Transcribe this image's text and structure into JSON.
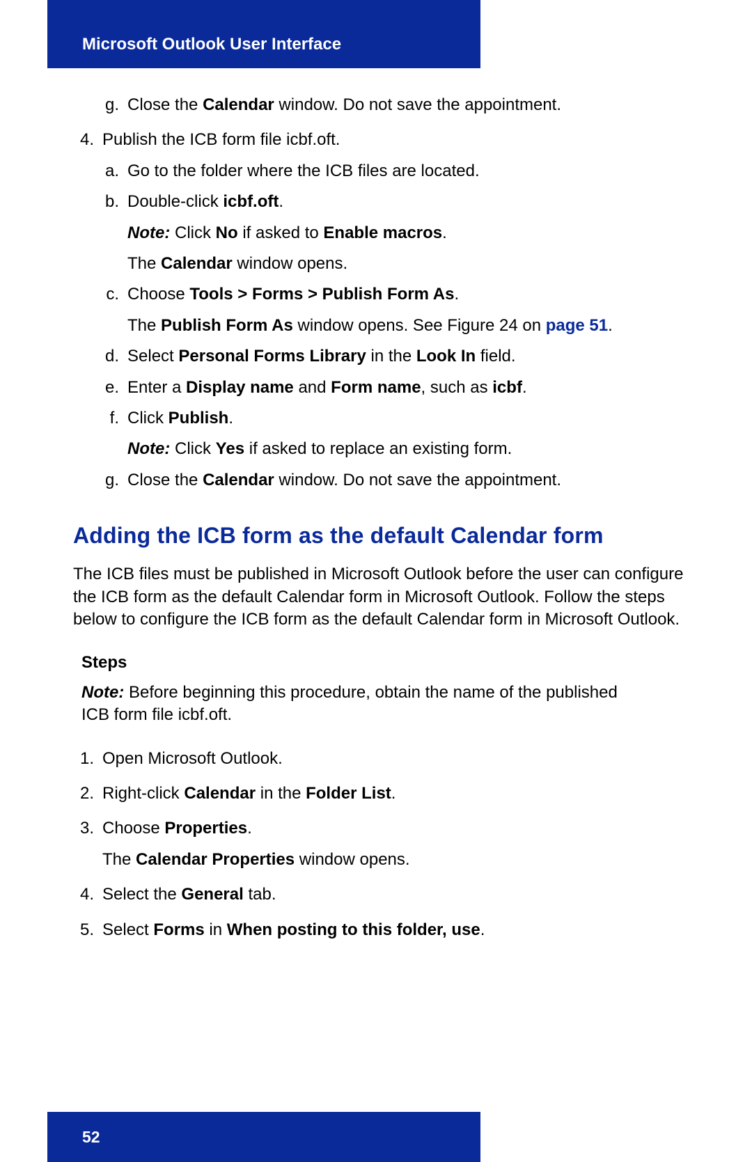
{
  "header": "Microsoft Outlook User Interface",
  "prev_g": {
    "marker": "g.",
    "pre": "Close the ",
    "b1": "Calendar",
    "post": " window. Do not save the appointment."
  },
  "step4": {
    "marker": "4.",
    "text": "Publish the ICB form file icbf.oft.",
    "a": {
      "marker": "a.",
      "text": "Go to the folder where the ICB files are located."
    },
    "b": {
      "marker": "b.",
      "pre": "Double-click ",
      "b1": "icbf.oft",
      "post": "."
    },
    "b_note": {
      "label": "Note:",
      "pre": " Click ",
      "b1": "No",
      "mid": " if asked to ",
      "b2": "Enable macros",
      "post": "."
    },
    "b_after": {
      "pre": "The ",
      "b1": "Calendar",
      "post": " window opens."
    },
    "c": {
      "marker": "c.",
      "pre": "Choose ",
      "b1": "Tools > Forms > Publish Form As",
      "post": "."
    },
    "c_after": {
      "pre": "The ",
      "b1": "Publish Form As",
      "mid": " window opens. See Figure 24 on ",
      "link": "page 51",
      "post": "."
    },
    "d": {
      "marker": "d.",
      "pre": "Select ",
      "b1": "Personal Forms Library",
      "mid": " in the ",
      "b2": "Look In",
      "post": " field."
    },
    "e": {
      "marker": "e.",
      "pre": "Enter a ",
      "b1": "Display name",
      "mid": " and ",
      "b2": "Form name",
      "mid2": ", such as ",
      "b3": "icbf",
      "post": "."
    },
    "f": {
      "marker": "f.",
      "pre": "Click ",
      "b1": "Publish",
      "post": "."
    },
    "f_note": {
      "label": "Note:",
      "pre": " Click ",
      "b1": "Yes",
      "post": " if asked to replace an existing form."
    },
    "g": {
      "marker": "g.",
      "pre": "Close the ",
      "b1": "Calendar",
      "post": " window. Do not save the appointment."
    }
  },
  "section2": {
    "heading": "Adding the ICB form as the default Calendar form",
    "para": "The ICB files must be published in Microsoft Outlook before the user can configure the ICB form as the default Calendar form in Microsoft Outlook. Follow the steps below to configure the ICB form as the default Calendar form in Microsoft Outlook.",
    "steps_label": "Steps",
    "steps_note": {
      "label": "Note:",
      "text": " Before beginning this procedure, obtain the name of the published ICB form file icbf.oft."
    },
    "s1": {
      "marker": "1.",
      "text": "Open Microsoft Outlook."
    },
    "s2": {
      "marker": "2.",
      "pre": "Right-click ",
      "b1": "Calendar",
      "mid": " in the ",
      "b2": "Folder List",
      "post": "."
    },
    "s3": {
      "marker": "3.",
      "pre": "Choose ",
      "b1": "Properties",
      "post": "."
    },
    "s3_after": {
      "pre": "The ",
      "b1": "Calendar Properties",
      "post": " window opens."
    },
    "s4": {
      "marker": "4.",
      "pre": "Select the ",
      "b1": "General",
      "post": " tab."
    },
    "s5": {
      "marker": "5.",
      "pre": "Select ",
      "b1": "Forms",
      "mid": " in ",
      "b2": "When posting to this folder, use",
      "post": "."
    }
  },
  "page_number": "52"
}
